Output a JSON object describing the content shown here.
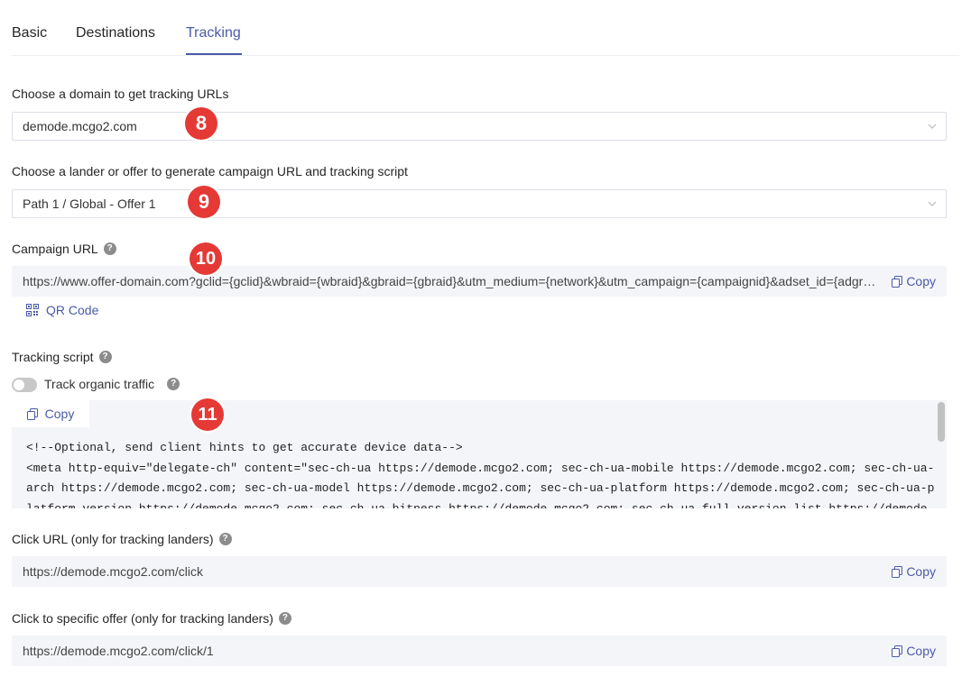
{
  "tabs": [
    {
      "label": "Basic"
    },
    {
      "label": "Destinations"
    },
    {
      "label": "Tracking"
    }
  ],
  "domain": {
    "label": "Choose a domain to get tracking URLs",
    "value": "demode.mcgo2.com"
  },
  "lander": {
    "label": "Choose a lander or offer to generate campaign URL and tracking script",
    "value": "Path 1 / Global - Offer 1"
  },
  "campaign_url": {
    "label": "Campaign URL",
    "value": "https://www.offer-domain.com?gclid={gclid}&wbraid={wbraid}&gbraid={gbraid}&utm_medium={network}&utm_campaign={campaignid}&adset_id={adgroupid}",
    "copy_label": "Copy",
    "qr_label": "QR Code"
  },
  "tracking_script": {
    "label": "Tracking script",
    "toggle_label": "Track organic traffic",
    "copy_label": "Copy",
    "code": "<!--Optional, send client hints to get accurate device data-->\n<meta http-equiv=\"delegate-ch\" content=\"sec-ch-ua https://demode.mcgo2.com; sec-ch-ua-mobile https://demode.mcgo2.com; sec-ch-ua-arch https://demode.mcgo2.com; sec-ch-ua-model https://demode.mcgo2.com; sec-ch-ua-platform https://demode.mcgo2.com; sec-ch-ua-platform-version https://demode.mcgo2.com; sec-ch-ua-bitness https://demode.mcgo2.com; sec-ch-ua-full-version-list https://demode.mcgo2.com\">"
  },
  "click_url": {
    "label": "Click URL (only for tracking landers)",
    "value": "https://demode.mcgo2.com/click",
    "copy_label": "Copy"
  },
  "specific_offer": {
    "label": "Click to specific offer (only for tracking landers)",
    "value": "https://demode.mcgo2.com/click/1",
    "copy_label": "Copy"
  },
  "annotations": [
    "8",
    "9",
    "10",
    "11"
  ],
  "colors": {
    "accent": "#4a5aa8",
    "badge": "#e53935",
    "field_bg": "#f4f5f8"
  }
}
